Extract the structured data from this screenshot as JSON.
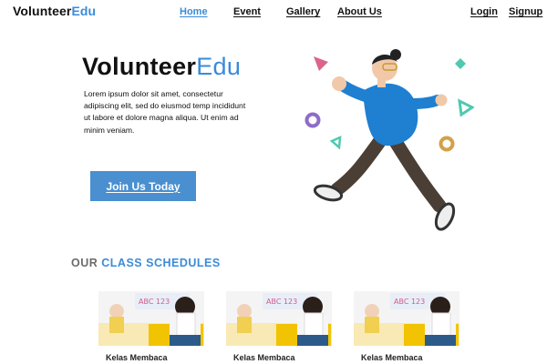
{
  "nav": {
    "logo_part1": "Volunteer",
    "logo_part2": "Edu",
    "links": [
      {
        "label": "Home",
        "active": true
      },
      {
        "label": "Event",
        "active": false
      },
      {
        "label": "Gallery",
        "active": false
      },
      {
        "label": "About Us",
        "active": false
      }
    ],
    "login_label": "Login",
    "signup_label": "Signup"
  },
  "hero": {
    "title_part1": "Volunteer",
    "title_part2": "Edu",
    "body": "Lorem ipsum dolor sit amet, consectetur adipiscing elit, sed do eiusmod temp incididunt ut labore et dolore magna aliqua. Ut enim ad minim veniam.",
    "cta_label": "Join Us Today"
  },
  "schedules": {
    "title_part1": "OUR",
    "title_part2": "CLASS SCHEDULES",
    "cards": [
      {
        "caption": "Kelas Membaca"
      },
      {
        "caption": "Kelas Membaca"
      },
      {
        "caption": "Kelas Membaca"
      }
    ]
  },
  "colors": {
    "accent": "#3a8bd8",
    "button": "#4a8fcf",
    "heading_gray": "#6c6c6c"
  },
  "icons": {
    "hero_illustration": "running-person-illustration",
    "card_image": "classroom-photo"
  }
}
